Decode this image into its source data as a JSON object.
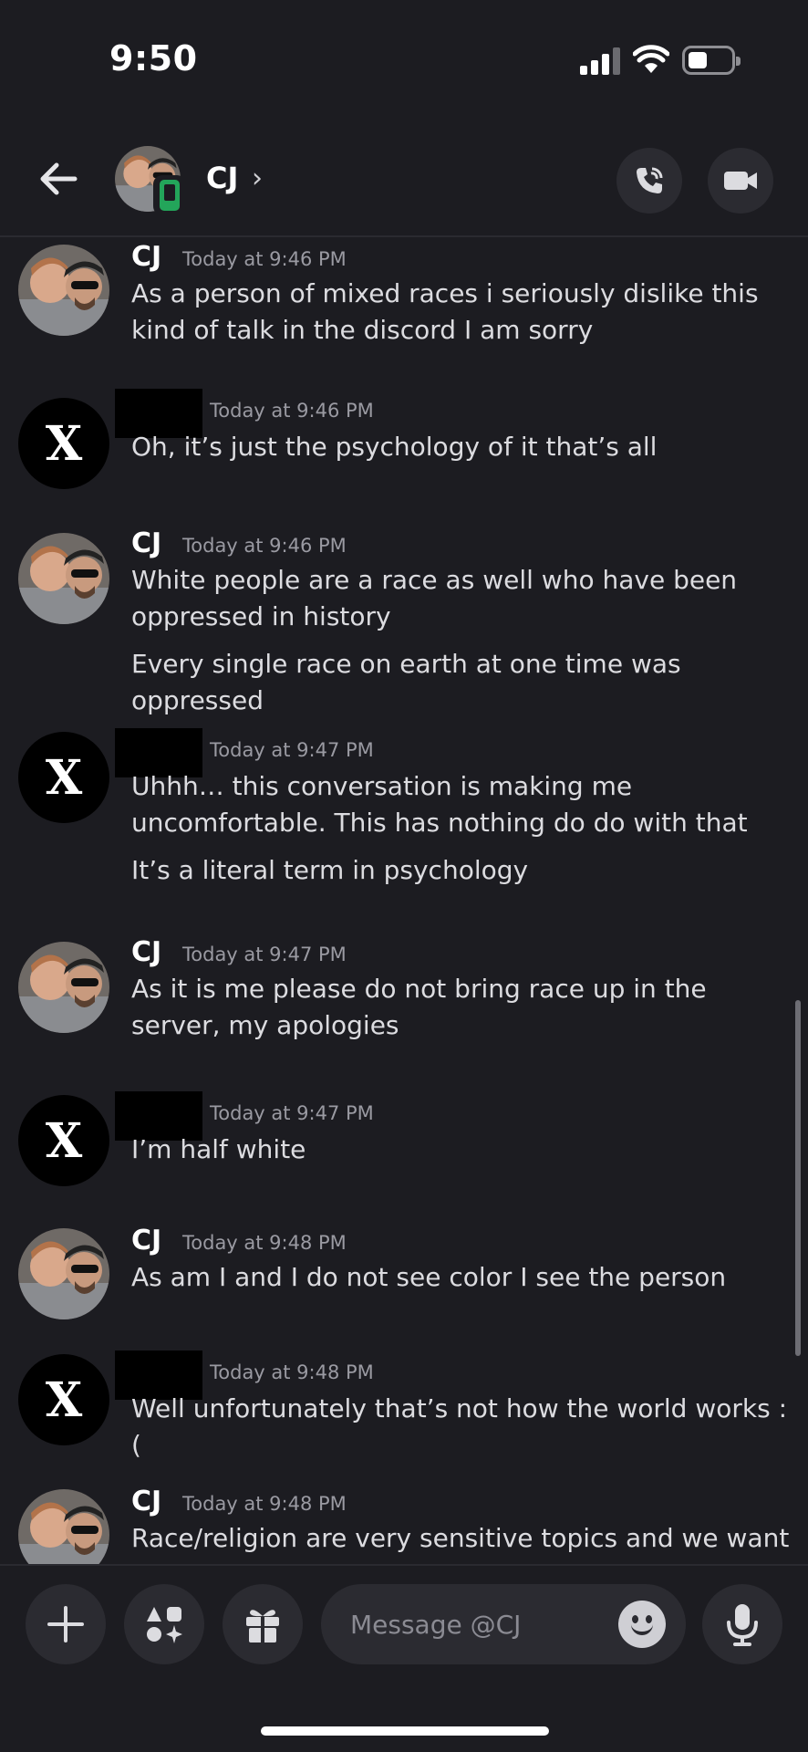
{
  "status_bar": {
    "time": "9:50"
  },
  "header": {
    "name": "CJ",
    "chevron": "›"
  },
  "messages": [
    {
      "author": "CJ",
      "time": "Today at 9:46 PM",
      "text": "As a person of mixed races i seriously dislike this kind of talk in the discord I am sorry"
    },
    {
      "author": "",
      "avatar_letter": "X",
      "time": "Today at 9:46 PM",
      "text": "Oh, it’s just the psychology of it that’s all"
    },
    {
      "author": "CJ",
      "time": "Today at 9:46 PM",
      "text": "White people are a race as well who have been oppressed in history",
      "text2": "Every single race on earth at one time was oppressed"
    },
    {
      "author": "",
      "avatar_letter": "X",
      "time": "Today at 9:47 PM",
      "text": "Uhhh… this conversation is making me uncomfortable. This has nothing do do with that",
      "text2": "It’s a literal term in psychology"
    },
    {
      "author": "CJ",
      "time": "Today at 9:47 PM",
      "text": "As it is me please do not bring race up in the server, my apologies"
    },
    {
      "author": "",
      "avatar_letter": "X",
      "time": "Today at 9:47 PM",
      "text": "I’m half white"
    },
    {
      "author": "CJ",
      "time": "Today at 9:48 PM",
      "text": "As am I and I do not see color I see the person"
    },
    {
      "author": "",
      "avatar_letter": "X",
      "time": "Today at 9:48 PM",
      "text": "Well unfortunately that’s not how the world works :("
    },
    {
      "author": "CJ",
      "time": "Today at 9:48 PM",
      "text": "Race/religion are very sensitive topics and we want"
    }
  ],
  "composer": {
    "placeholder": "Message @CJ"
  },
  "icons": {
    "back": "arrow-left-icon",
    "call": "phone-call-icon",
    "video": "video-camera-icon",
    "plus": "plus-icon",
    "apps": "apps-icon",
    "gift": "gift-icon",
    "emoji": "emoji-icon",
    "mic": "microphone-icon"
  },
  "colors": {
    "background": "#1c1c21",
    "online_mobile": "#23a55a",
    "button_bg": "#2b2b31"
  }
}
